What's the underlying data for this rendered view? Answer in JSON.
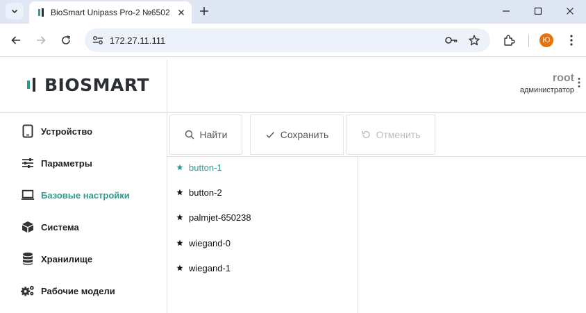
{
  "browser": {
    "tab_title": "BioSmart Unipass Pro-2 №6502",
    "url": "172.27.11.111",
    "profile_initial": "Ю"
  },
  "app": {
    "logo_text": "BIOSMART",
    "user": {
      "name": "root",
      "role": "администратор"
    },
    "sidebar": {
      "items": [
        {
          "label": "Устройство",
          "icon": "tablet-icon",
          "active": false
        },
        {
          "label": "Параметры",
          "icon": "sliders-icon",
          "active": false
        },
        {
          "label": "Базовые настройки",
          "icon": "laptop-icon",
          "active": true
        },
        {
          "label": "Система",
          "icon": "cube-icon",
          "active": false
        },
        {
          "label": "Хранилище",
          "icon": "database-icon",
          "active": false
        },
        {
          "label": "Рабочие модели",
          "icon": "gears-icon",
          "active": false
        }
      ]
    },
    "actions": {
      "find_label": "Найти",
      "save_label": "Сохранить",
      "cancel_label": "Отменить"
    },
    "list": {
      "items": [
        {
          "label": "button-1",
          "active": true
        },
        {
          "label": "button-2",
          "active": false
        },
        {
          "label": "palmjet-650238",
          "active": false
        },
        {
          "label": "wiegand-0",
          "active": false
        },
        {
          "label": "wiegand-1",
          "active": false
        }
      ]
    },
    "colors": {
      "accent": "#2a9d8f",
      "disabled": "#bcbcbc"
    }
  }
}
